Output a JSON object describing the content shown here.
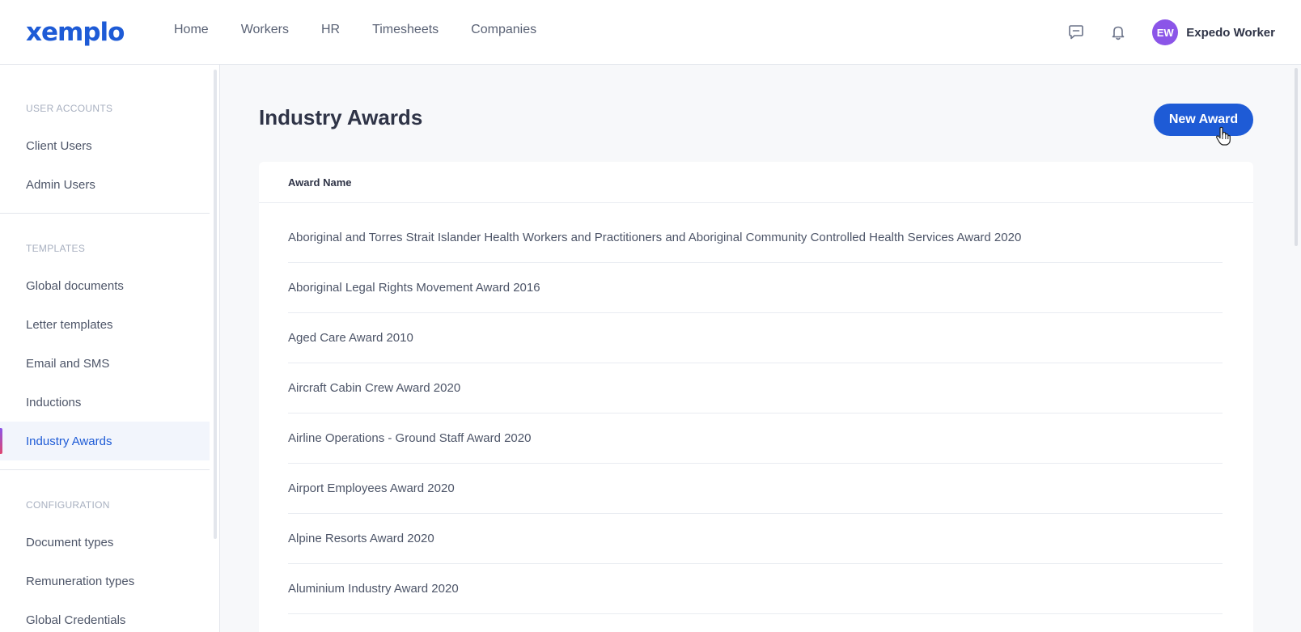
{
  "app": {
    "logo_text": "xemplo",
    "brand_color": "#1e5bd6"
  },
  "nav": {
    "items": [
      "Home",
      "Workers",
      "HR",
      "Timesheets",
      "Companies"
    ]
  },
  "user": {
    "initials": "EW",
    "name": "Expedo Worker",
    "avatar_color": "#8b55e8"
  },
  "sidebar": {
    "sections": [
      {
        "label": "USER ACCOUNTS",
        "items": [
          "Client Users",
          "Admin Users"
        ]
      },
      {
        "label": "TEMPLATES",
        "items": [
          "Global documents",
          "Letter templates",
          "Email and SMS",
          "Inductions",
          "Industry Awards"
        ]
      },
      {
        "label": "CONFIGURATION",
        "items": [
          "Document types",
          "Remuneration types",
          "Global Credentials"
        ]
      }
    ],
    "active_item": "Industry Awards"
  },
  "main": {
    "title": "Industry Awards",
    "new_button_label": "New Award",
    "table": {
      "columns": [
        "Award Name"
      ],
      "rows": [
        "Aboriginal and Torres Strait Islander Health Workers and Practitioners and Aboriginal Community Controlled Health Services Award 2020",
        "Aboriginal Legal Rights Movement Award 2016",
        "Aged Care Award 2010",
        "Aircraft Cabin Crew Award 2020",
        "Airline Operations - Ground Staff Award 2020",
        "Airport Employees Award 2020",
        "Alpine Resorts Award 2020",
        "Aluminium Industry Award 2020"
      ]
    }
  },
  "icons": {
    "chat": "chat-icon",
    "bell": "bell-icon",
    "cursor": "hand-pointer-icon"
  }
}
